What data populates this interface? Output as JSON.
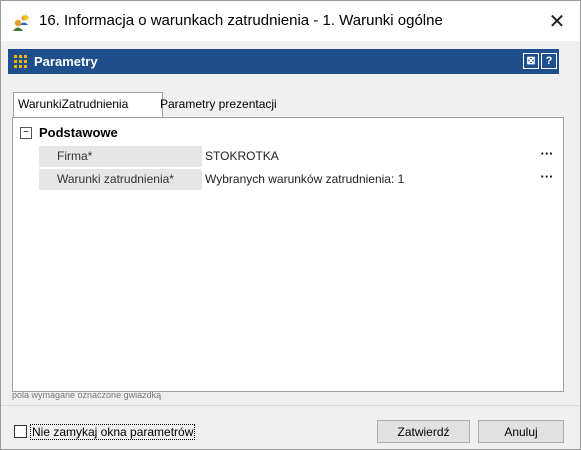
{
  "window": {
    "title": "16. Informacja o warunkach zatrudnienia - 1. Warunki ogólne",
    "close_glyph": "✕"
  },
  "panel": {
    "title": "Parametry",
    "btn_restore": "⊠",
    "btn_help": "?"
  },
  "tabs": [
    {
      "label": "WarunkiZatrudnienia",
      "active": true
    },
    {
      "label": "Parametry prezentacji",
      "active": false
    }
  ],
  "group": {
    "collapse_glyph": "−",
    "label": "Podstawowe"
  },
  "properties": [
    {
      "name": "Firma*",
      "value": "STOKROTKA",
      "button": "···"
    },
    {
      "name": "Warunki zatrudnienia*",
      "value": "Wybranych warunków zatrudnienia: 1",
      "button": "···"
    }
  ],
  "footnote": "pola wymagane oznaczone gwiazdką",
  "keep_open": {
    "label": "Nie zamykaj okna parametrów",
    "checked": false
  },
  "buttons": {
    "ok": "Zatwierdź",
    "cancel": "Anuluj"
  },
  "colors": {
    "panel_header": "#1f4e8c",
    "property_name_bg": "#e6e6e6"
  }
}
